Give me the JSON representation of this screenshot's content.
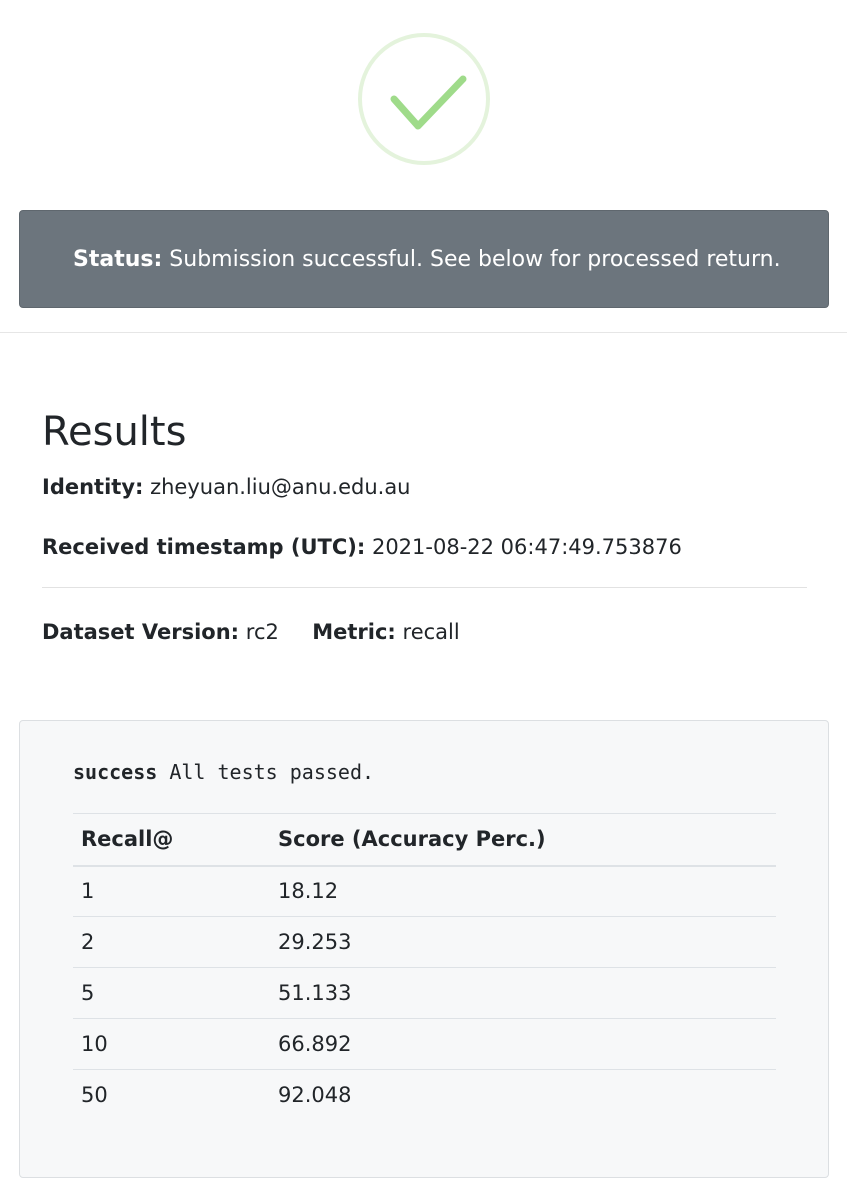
{
  "status": {
    "label": "Status:",
    "message": "Submission successful. See below for processed return."
  },
  "icons": {
    "success": "check-circle-icon",
    "success_color": "#9fdb8a",
    "ring_color": "#e4f3dc"
  },
  "colors": {
    "alert_bg": "#6c757d",
    "panel_bg": "#f7f8f9"
  },
  "results": {
    "title": "Results",
    "identity_label": "Identity:",
    "identity_value": "zheyuan.liu@anu.edu.au",
    "timestamp_label": "Received timestamp (UTC):",
    "timestamp_value": "2021-08-22 06:47:49.753876",
    "dataset_label": "Dataset Version:",
    "dataset_value": "rc2",
    "metric_label": "Metric:",
    "metric_value": "recall"
  },
  "output": {
    "keyword": "success",
    "message": "All tests passed."
  },
  "table": {
    "headers": [
      "Recall@",
      "Score (Accuracy Perc.)"
    ],
    "rows": [
      [
        "1",
        "18.12"
      ],
      [
        "2",
        "29.253"
      ],
      [
        "5",
        "51.133"
      ],
      [
        "10",
        "66.892"
      ],
      [
        "50",
        "92.048"
      ]
    ]
  }
}
